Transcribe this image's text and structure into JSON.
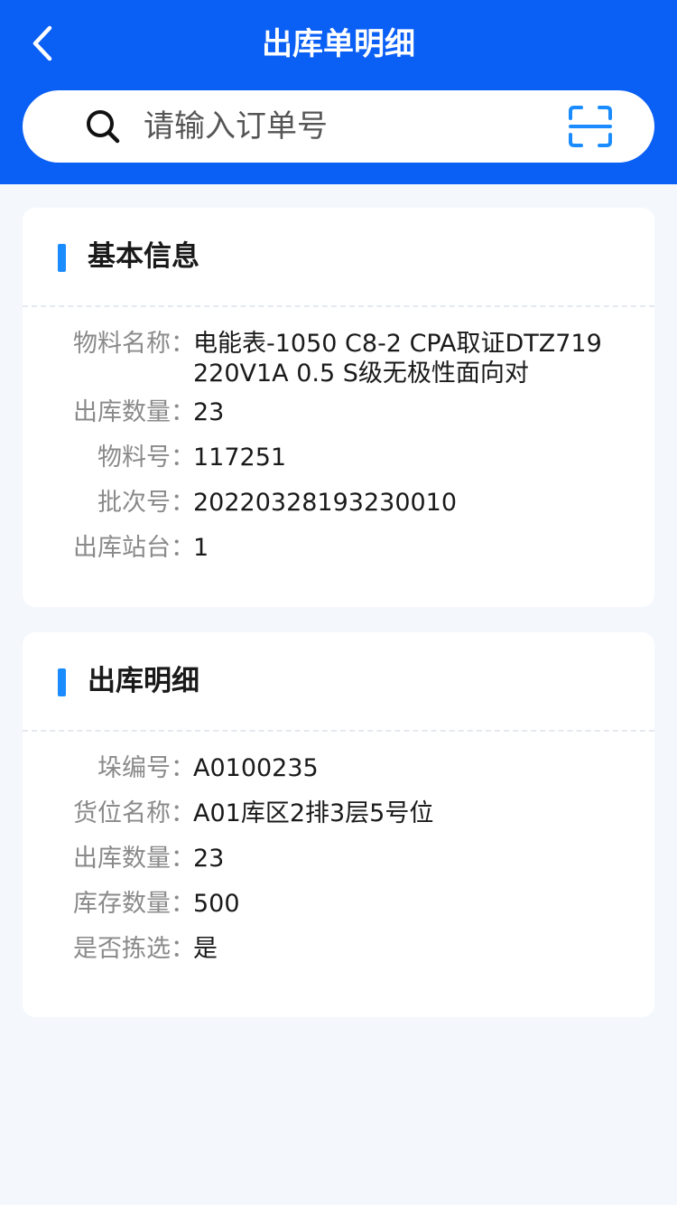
{
  "header": {
    "title": "出库单明细",
    "back_icon": "chevron-left-icon",
    "background_color": "#0a5ff5"
  },
  "search": {
    "placeholder": "请输入订单号",
    "value": "",
    "search_icon": "search-icon",
    "scan_icon": "scan-icon",
    "scan_icon_color": "#1a8cff"
  },
  "basic_info": {
    "title": "基本信息",
    "accent_color": "#1a8cff",
    "rows": [
      {
        "label": "物料名称",
        "value": "电能表-1050 C8-2 CPA取证DTZ719 220V1A 0.5 S级无极性面向对"
      },
      {
        "label": "出库数量",
        "value": "23"
      },
      {
        "label": "物料号",
        "value": "117251"
      },
      {
        "label": "批次号",
        "value": "20220328193230010"
      },
      {
        "label": "出库站台",
        "value": "1"
      }
    ]
  },
  "outbound_detail": {
    "title": "出库明细",
    "rows": [
      {
        "label": "垛编号",
        "value": "A0100235"
      },
      {
        "label": "货位名称",
        "value": "A01库区2排3层5号位"
      },
      {
        "label": "出库数量",
        "value": "23"
      },
      {
        "label": "库存数量",
        "value": "500"
      },
      {
        "label": "是否拣选",
        "value": "是"
      }
    ]
  },
  "colon": "："
}
